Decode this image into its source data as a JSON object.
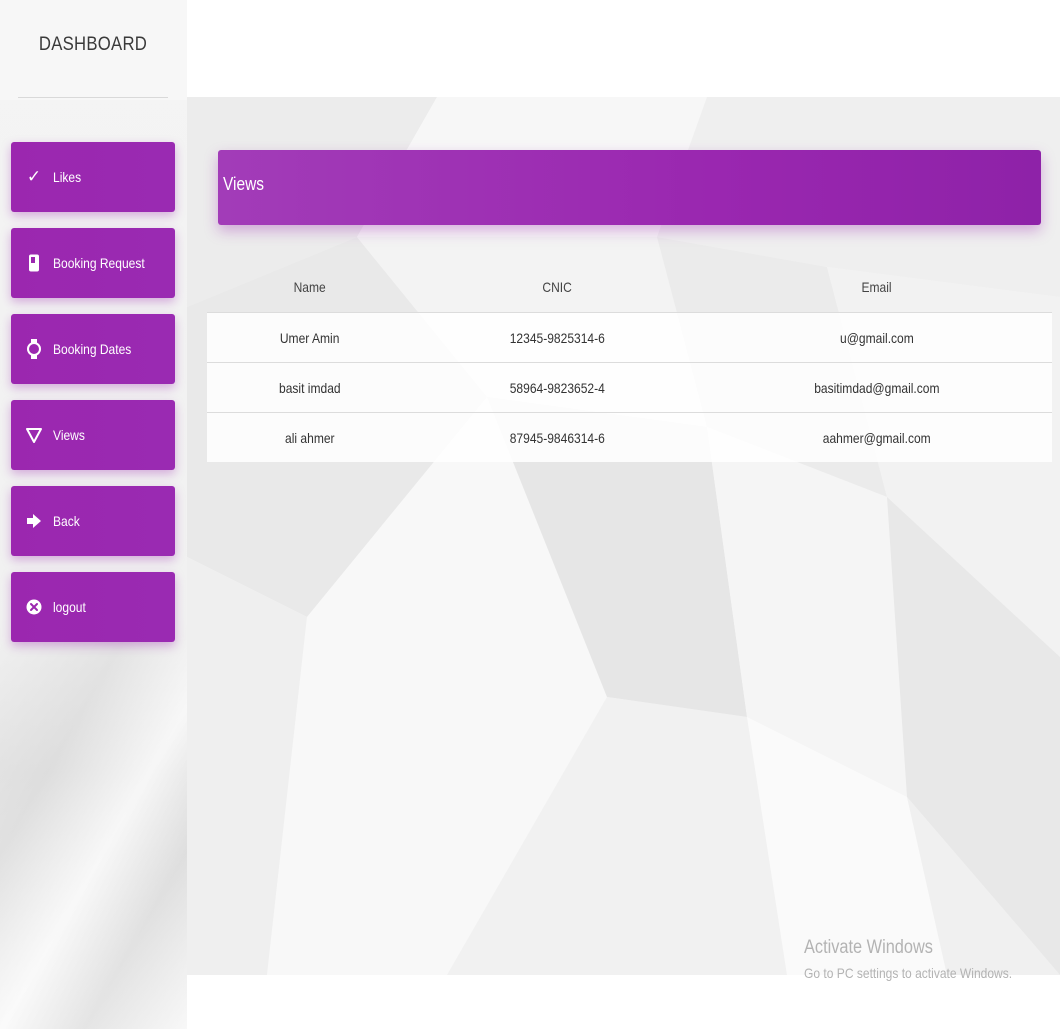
{
  "sidebar": {
    "brand": "DASHBOARD",
    "items": [
      {
        "label": "Likes",
        "icon": "check-icon"
      },
      {
        "label": "Booking Request",
        "icon": "phone-icon"
      },
      {
        "label": "Booking Dates",
        "icon": "watch-icon"
      },
      {
        "label": "Views",
        "icon": "triangle-down-icon"
      },
      {
        "label": "Back",
        "icon": "arrow-right-icon"
      },
      {
        "label": "logout",
        "icon": "close-circle-icon"
      }
    ]
  },
  "card": {
    "title": "Views"
  },
  "table": {
    "headers": [
      "Name",
      "CNIC",
      "Email"
    ],
    "rows": [
      [
        "Umer Amin",
        "12345-9825314-6",
        "u@gmail.com"
      ],
      [
        "basit imdad",
        "58964-9823652-4",
        "basitimdad@gmail.com"
      ],
      [
        "ali ahmer",
        "87945-9846314-6",
        "aahmer@gmail.com"
      ]
    ]
  },
  "watermark": {
    "title": "Activate Windows",
    "subtitle": "Go to PC settings to activate Windows."
  },
  "colors": {
    "accent": "#9c27b0",
    "background": "#f5f5f5"
  }
}
